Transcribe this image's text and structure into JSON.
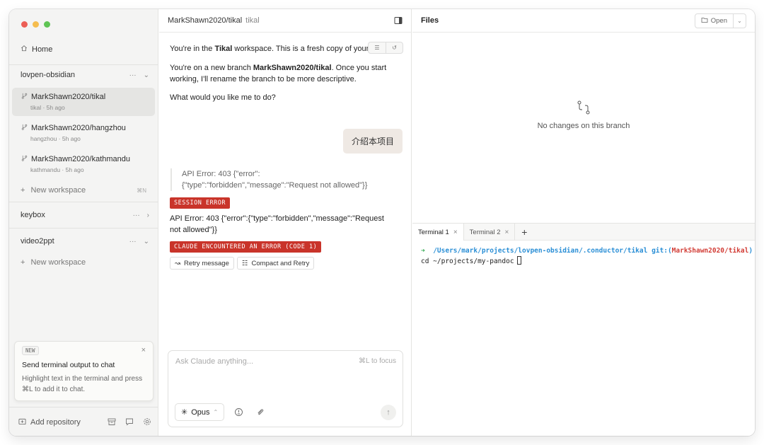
{
  "sidebar": {
    "home_label": "Home",
    "repos": [
      {
        "name": "lovpen-obsidian",
        "more": "···",
        "toggle": "⌄"
      },
      {
        "name": "keybox",
        "more": "···",
        "toggle": "›"
      },
      {
        "name": "video2ppt",
        "more": "···",
        "toggle": "⌄"
      }
    ],
    "workspaces": [
      {
        "branch": "MarkShawn2020/tikal",
        "sub": "tikal · 5h ago"
      },
      {
        "branch": "MarkShawn2020/hangzhou",
        "sub": "hangzhou · 5h ago"
      },
      {
        "branch": "MarkShawn2020/kathmandu",
        "sub": "kathmandu · 5h ago"
      }
    ],
    "new_workspace_label": "New workspace",
    "new_workspace_shortcut": "⌘N",
    "tip": {
      "badge": "NEW",
      "title": "Send terminal output to chat",
      "body": "Highlight text in the terminal and press ⌘L to add it to chat."
    },
    "add_repository_label": "Add repository"
  },
  "chat": {
    "header_branch": "MarkShawn2020/tikal",
    "header_workspace": "tikal",
    "msg1_pre": "You're in the ",
    "msg1_bold": "Tikal",
    "msg1_post": " workspace. This is a fresh copy of your c",
    "msg2_pre": "You're on a new branch ",
    "msg2_bold": "MarkShawn2020/tikal",
    "msg2_post": ". Once you start working, I'll rename the branch to be more descriptive.",
    "msg3": "What would you like me to do?",
    "user_message": "介绍本项目",
    "quote_error": "API Error: 403 {\"error\":{\"type\":\"forbidden\",\"message\":\"Request not allowed\"}}",
    "session_error_badge": "SESSION ERROR",
    "api_error": "API Error: 403 {\"error\":{\"type\":\"forbidden\",\"message\":\"Request not allowed\"}}",
    "claude_error_badge": "CLAUDE ENCOUNTERED AN ERROR (CODE 1)",
    "retry_label": "Retry message",
    "compact_label": "Compact and Retry",
    "composer_placeholder": "Ask Claude anything...",
    "composer_hint": "⌘L to focus",
    "model_label": "Opus"
  },
  "files": {
    "title": "Files",
    "open_label": "Open",
    "empty_text": "No changes on this branch",
    "terminal_tabs": [
      "Terminal 1",
      "Terminal 2"
    ],
    "terminal": {
      "arrow": "➜",
      "path": "/Users/mark/projects/lovpen-obsidian/.conductor/tikal",
      "git_open": "git:(",
      "branch": "MarkShawn2020/tikal",
      "git_close": ")",
      "line2": "cd ~/projects/my-pandoc"
    }
  },
  "colors": {
    "error_badge": "#c9342a",
    "terminal_path": "#2b8fd6",
    "terminal_branch": "#d23d36",
    "terminal_arrow": "#2fa84f"
  }
}
